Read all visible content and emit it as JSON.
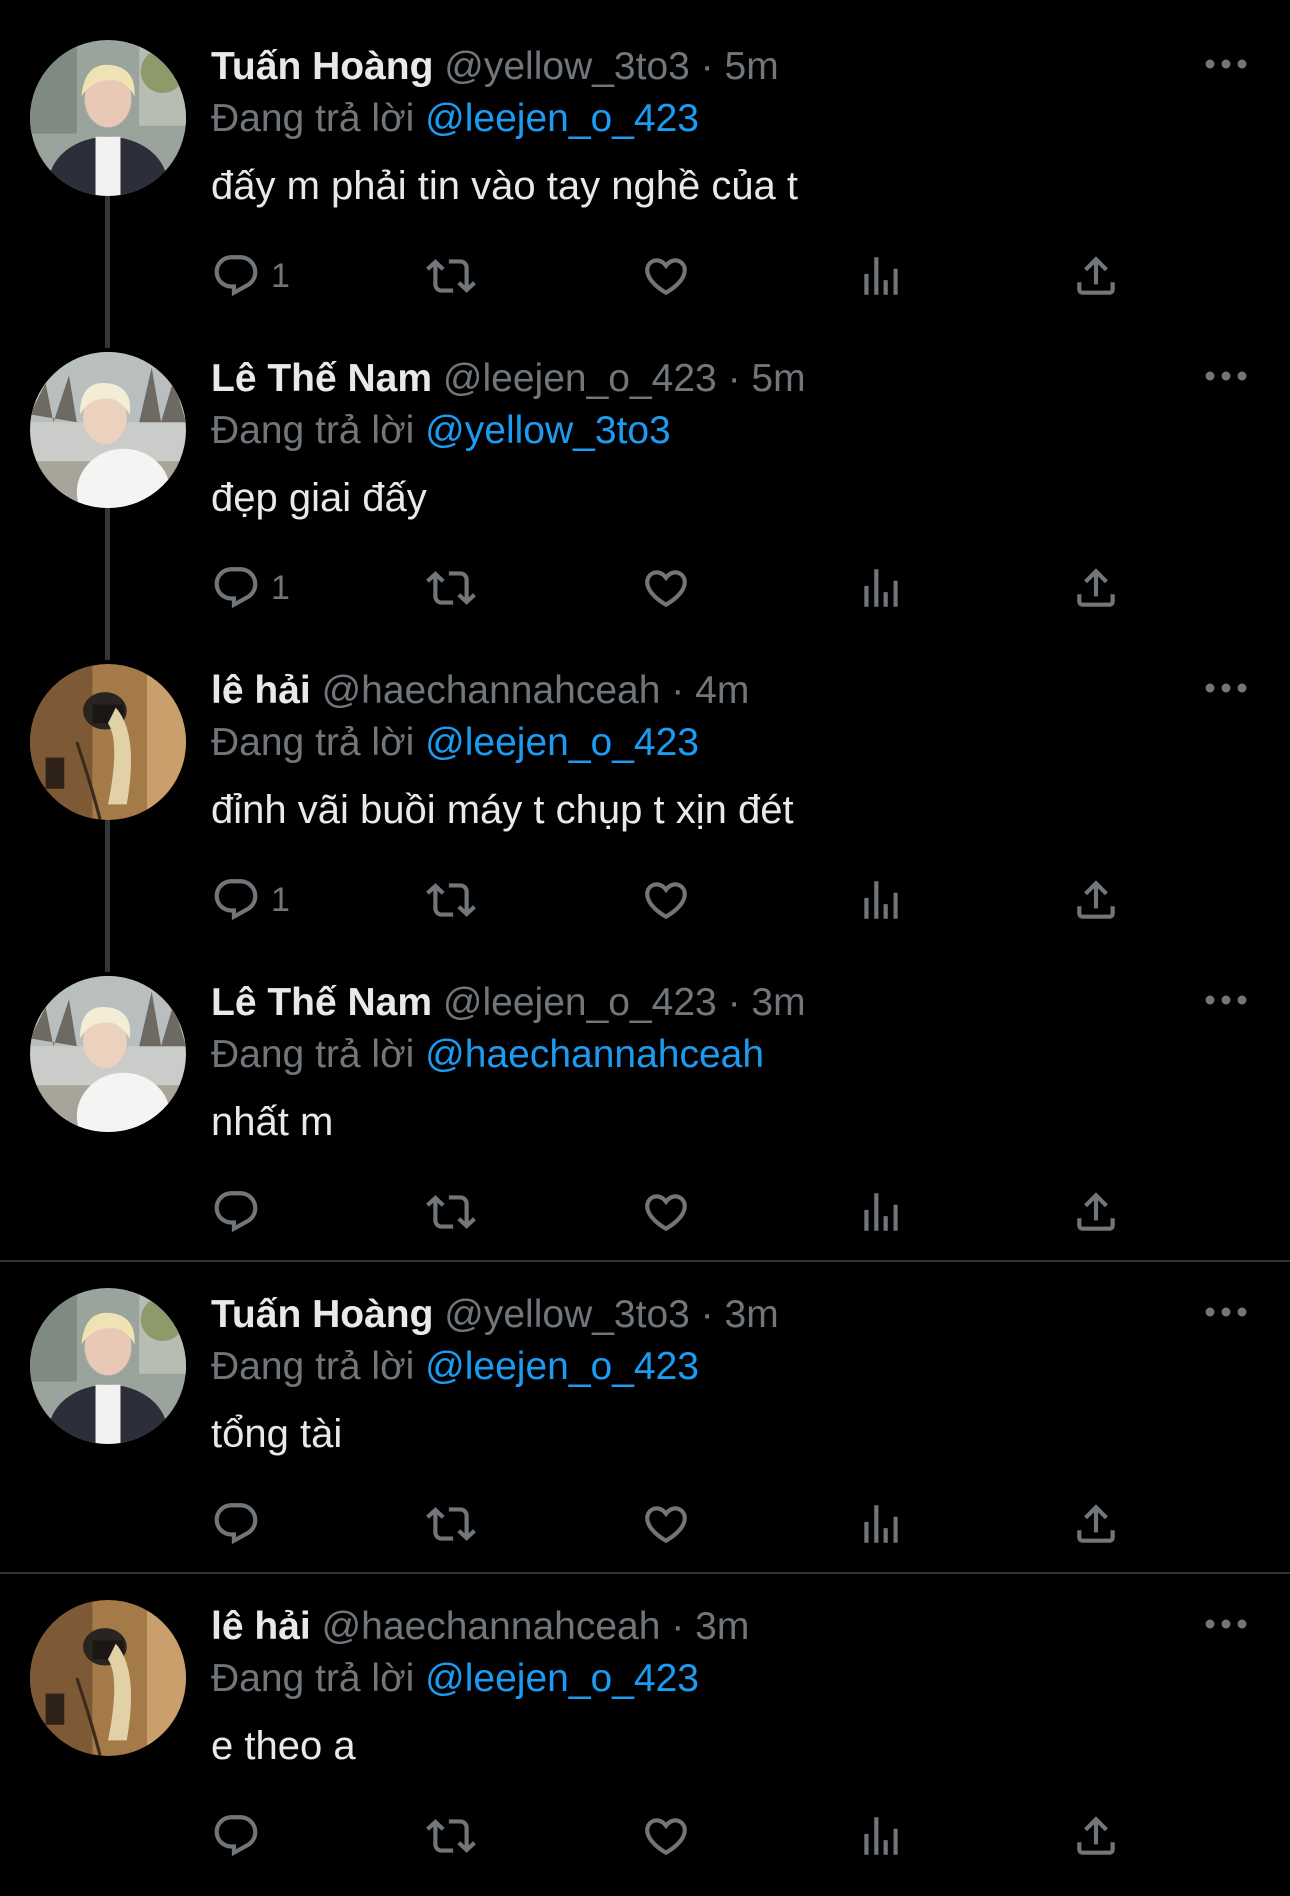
{
  "tweets": [
    {
      "name": "Tuấn Hoàng",
      "handle": "@yellow_3to3",
      "dot": "·",
      "time": "5m",
      "replying_prefix": "Đang trả lời",
      "mention": "@leejen_o_423",
      "text": "đấy m phải tin vào tay nghề của t",
      "reply_count": "1",
      "avatar": "avatar-tuan"
    },
    {
      "name": "Lê Thế Nam",
      "handle": "@leejen_o_423",
      "dot": "·",
      "time": "5m",
      "replying_prefix": "Đang trả lời",
      "mention": "@yellow_3to3",
      "text": "đẹp giai đấy",
      "reply_count": "1",
      "avatar": "avatar-nam"
    },
    {
      "name": "lê hải",
      "handle": "@haechannahceah",
      "dot": "·",
      "time": "4m",
      "replying_prefix": "Đang trả lời",
      "mention": "@leejen_o_423",
      "text": "đỉnh vãi buồi máy t chụp t xịn đét",
      "reply_count": "1",
      "avatar": "avatar-hai"
    },
    {
      "name": "Lê Thế Nam",
      "handle": "@leejen_o_423",
      "dot": "·",
      "time": "3m",
      "replying_prefix": "Đang trả lời",
      "mention": "@haechannahceah",
      "text": "nhất m",
      "reply_count": "",
      "avatar": "avatar-nam"
    },
    {
      "name": "Tuấn Hoàng",
      "handle": "@yellow_3to3",
      "dot": "·",
      "time": "3m",
      "replying_prefix": "Đang trả lời",
      "mention": "@leejen_o_423",
      "text": "tổng tài",
      "reply_count": "",
      "avatar": "avatar-tuan"
    },
    {
      "name": "lê hải",
      "handle": "@haechannahceah",
      "dot": "·",
      "time": "3m",
      "replying_prefix": "Đang trả lời",
      "mention": "@leejen_o_423",
      "text": "e theo a",
      "reply_count": "",
      "avatar": "avatar-hai"
    }
  ],
  "icons": {
    "reply": "reply-icon",
    "retweet": "retweet-icon",
    "like": "heart-icon",
    "views": "views-icon",
    "share": "share-icon",
    "more": "more-icon"
  },
  "colors": {
    "background": "#000000",
    "text": "#e7e9ea",
    "secondary": "#71767b",
    "mention": "#1d9bf0",
    "divider": "#2f3336"
  }
}
